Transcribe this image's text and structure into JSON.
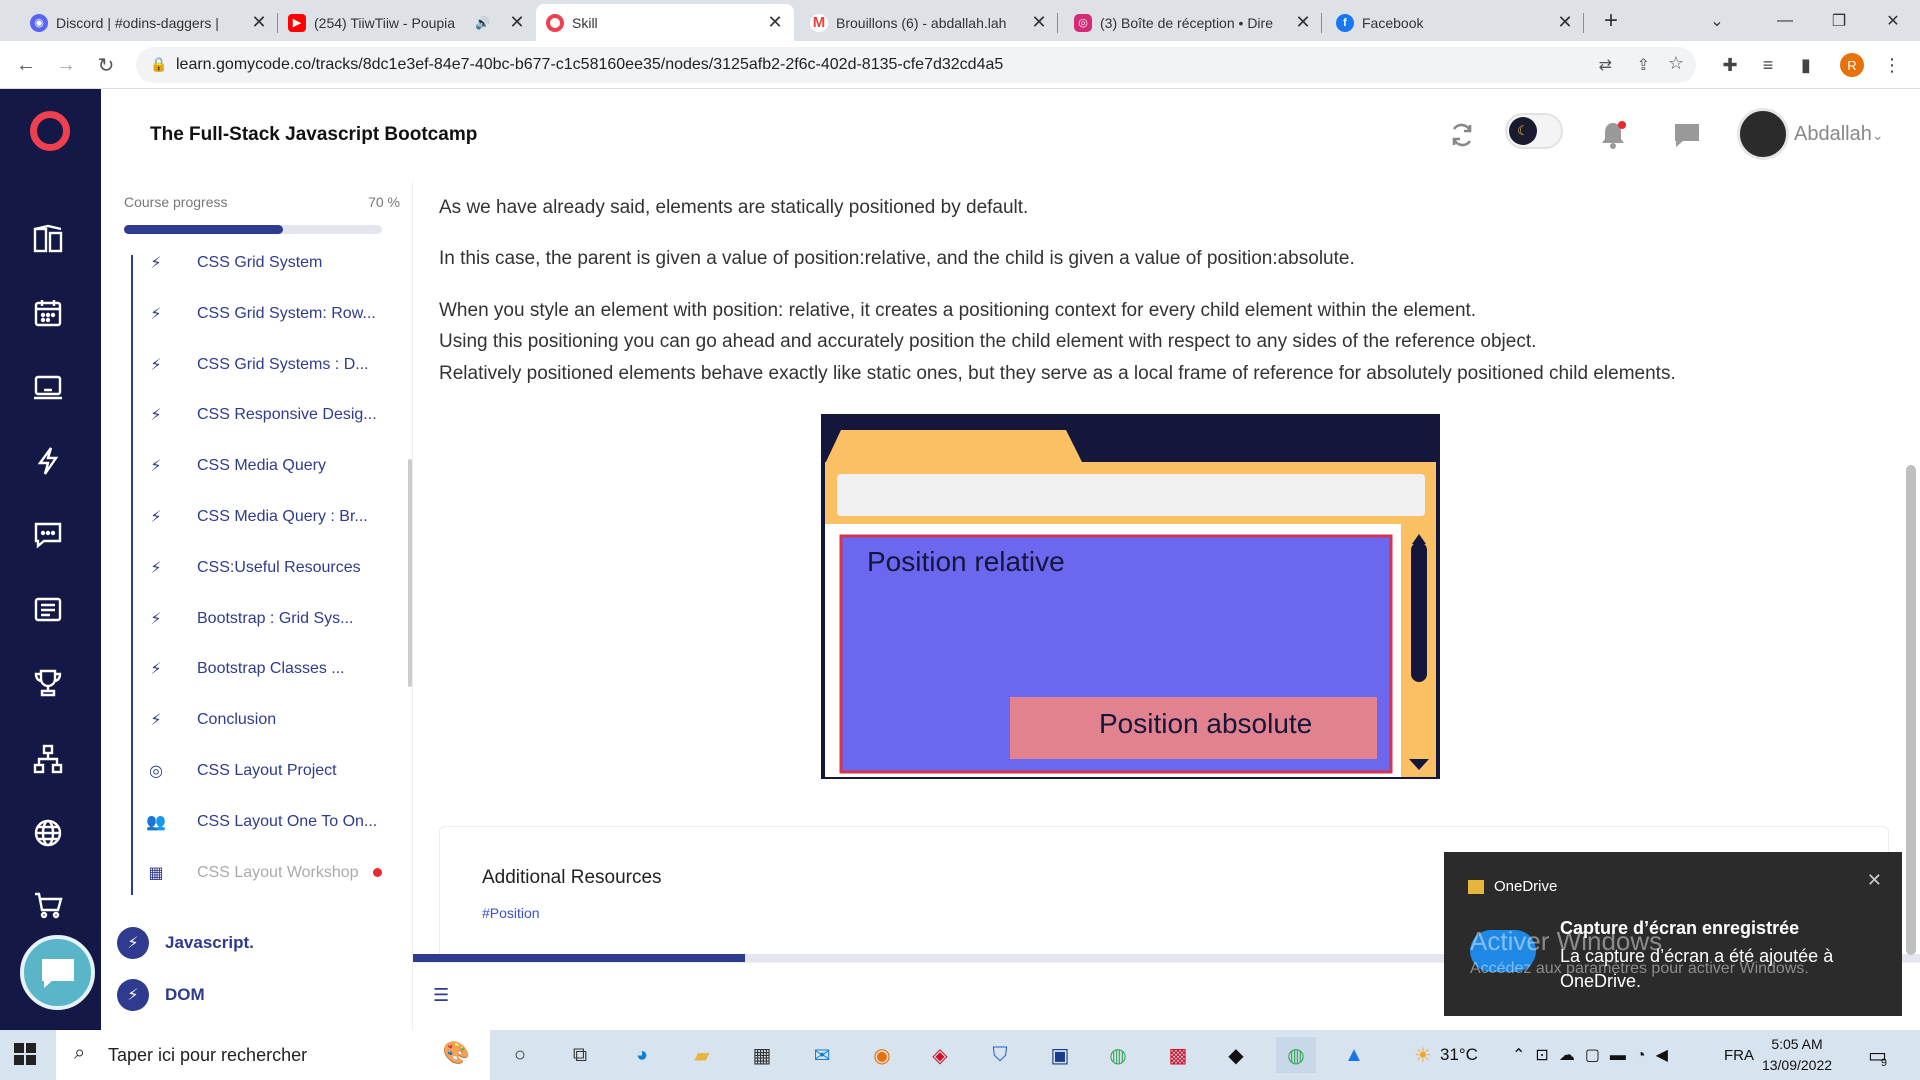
{
  "browser": {
    "tabs": [
      {
        "title": "Discord | #odins-daggers | ",
        "color": "#5865f2",
        "glyph": "◉"
      },
      {
        "title": "(254) TiiwTiiw - Poupia",
        "color": "#ff0000",
        "glyph": "▶"
      },
      {
        "title": "Skill",
        "color": "#ef4050",
        "glyph": "◯"
      },
      {
        "title": "Brouillons (6) - abdallah.lah",
        "color": "#ea4335",
        "glyph": "M"
      },
      {
        "title": "(3) Boîte de réception • Dire",
        "color": "#d62976",
        "glyph": "◎"
      },
      {
        "title": "Facebook",
        "color": "#1877f2",
        "glyph": "f"
      }
    ],
    "close_glyph": "✕",
    "new_tab": "+",
    "url": "learn.gomycode.co/tracks/8dc1e3ef-84e7-40bc-b677-c1c58160ee35/nodes/3125afb2-2f6c-402d-8135-cfe7d32cd4a5",
    "profile_initial": "R"
  },
  "header": {
    "title": "The Full-Stack Javascript Bootcamp",
    "user": "Abdallah"
  },
  "sidebar": {
    "progress_label": "Course progress",
    "progress_value": "70 %",
    "progress_fraction": 0.7,
    "items": [
      {
        "label": "CSS Grid System",
        "icon": "bolt-icon"
      },
      {
        "label": "CSS Grid System: Row...",
        "icon": "bolt-icon"
      },
      {
        "label": "CSS Grid Systems : D...",
        "icon": "bolt-icon"
      },
      {
        "label": "CSS Responsive Desig...",
        "icon": "bolt-icon"
      },
      {
        "label": "CSS Media Query",
        "icon": "bolt-icon"
      },
      {
        "label": "CSS Media Query : Br...",
        "icon": "bolt-icon"
      },
      {
        "label": "CSS:Useful Resources",
        "icon": "bolt-icon"
      },
      {
        "label": "Bootstrap : Grid Sys...",
        "icon": "bolt-icon"
      },
      {
        "label": "Bootstrap Classes ...",
        "icon": "bolt-icon"
      },
      {
        "label": "Conclusion",
        "icon": "bolt-icon"
      },
      {
        "label": "CSS Layout Project",
        "icon": "target-icon"
      },
      {
        "label": "CSS Layout One To On...",
        "icon": "people-icon"
      },
      {
        "label": "CSS Layout Workshop",
        "icon": "workshop-icon"
      }
    ],
    "sections": [
      {
        "label": "Javascript."
      },
      {
        "label": "DOM"
      }
    ]
  },
  "content": {
    "p1": "As we have already said, elements are statically positioned by default.",
    "p2": "In this case, the parent is given a value of position:relative, and the child is given a value of position:absolute.",
    "p3a": "When you style an element with position: relative, it creates a positioning context for every child element within the element.",
    "p3b": "Using this positioning you can go ahead and accurately position the child element with respect to any sides of the reference object.",
    "p3c": "Relatively positioned elements behave exactly like static ones, but they serve as a local frame of reference for absolutely positioned child elements.",
    "figure": {
      "relative": "Position relative",
      "absolute": "Position absolute"
    },
    "resources_title": "Additional Resources",
    "resources_tag": "#Position",
    "read_progress_fraction": 0.22
  },
  "toast": {
    "app": "OneDrive",
    "title": "Capture d’écran enregistrée",
    "body": "La capture d’écran a été ajoutée à OneDrive.",
    "watermark_title": "Activer Windows",
    "watermark_body": "Accédez aux paramètres pour activer Windows."
  },
  "taskbar": {
    "search_placeholder": "Taper ici pour rechercher",
    "weather": "31°C",
    "lang": "FRA",
    "time": "5:05 AM",
    "date": "13/09/2022",
    "notif_count": "9"
  },
  "colors": {
    "brand": "#ef4050",
    "navy": "#141846",
    "accent": "#2f3b8e"
  }
}
